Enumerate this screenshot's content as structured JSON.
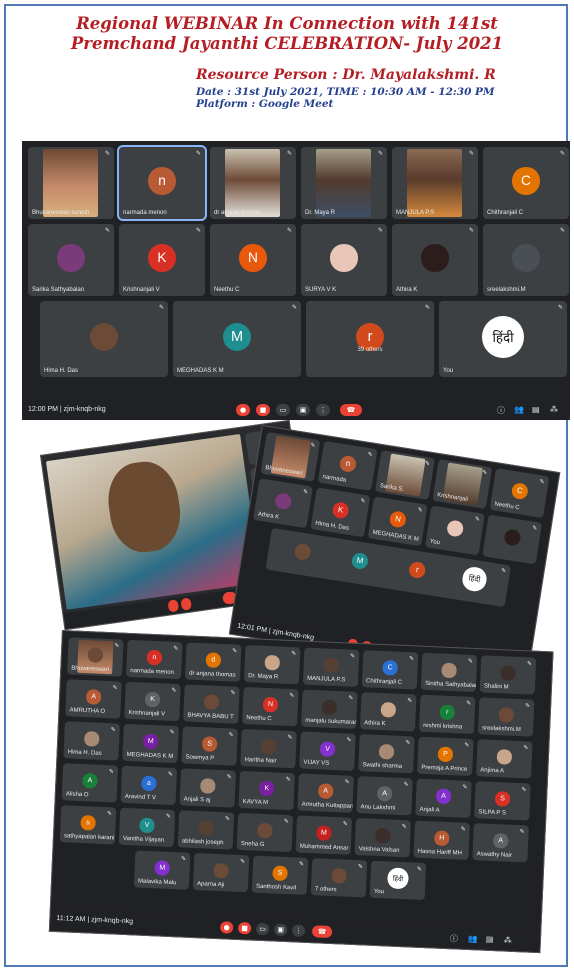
{
  "header": {
    "title_line1": "Regional WEBINAR In Connection with 141st",
    "title_line2": "Premchand Jayanthi CELEBRATION- July 2021",
    "resource_person": "Resource Person : Dr. Mayalakshmi. R",
    "date_time": "Date : 31st July 2021, TIME : 10:30 AM - 12:30 PM",
    "platform": "Platform    : Google Meet"
  },
  "meet1": {
    "clock": "12:00 PM  |  zjm-knqb-nkg",
    "participants": [
      "Bhuvaneswari suresh",
      "narmada menon",
      "dr anjana thomas",
      "Dr. Maya R",
      "MANJULA P.S",
      "Chithranjali C",
      "Sarika Sathyabalan",
      "Krishnanjali V",
      "Neethu C",
      "SURYA V K",
      "Athira K",
      "sreelakshmi.M",
      "Hima H. Das",
      "MEGHADAS K M",
      "39 others",
      "You"
    ],
    "avatar_letters": {
      "n": "n",
      "C": "C",
      "K": "K",
      "N": "N",
      "M": "M",
      "r": "r"
    },
    "hindi_text": "हिंदी"
  },
  "meet2": {
    "clock": "12:01 PM | zjm-knqb-nkg",
    "names": [
      "Bhuvaneswari",
      "narmada",
      "Sarika S.",
      "Krishnanjali",
      "Neethu C",
      "Athira K",
      "Hima H. Das",
      "MEGHADAS K M",
      "You"
    ]
  },
  "meet3": {
    "clock": "11:12 AM  |  zjm-knqb-nkg",
    "participants": [
      "Bhuvaneswari",
      "narmada menon",
      "dr anjana thomas",
      "Dr. Maya R",
      "MANJULA P.S",
      "Chithranjali C",
      "Sinitha Sathyabalan",
      "Shalini M",
      "AMRUTHA O",
      "Krishnanjali V",
      "BHAVYA BABU T",
      "Neethu C",
      "manjalu sukumaran",
      "Athira K",
      "reshmi krishna",
      "sreelakshmi.M",
      "Hima H. Das",
      "MEGHADAS K M",
      "Sowmya P",
      "Haritha Nair",
      "VIJAY VS",
      "Swathi sharma",
      "Premaja A Prince",
      "Anjima A",
      "Alisha O",
      "Aravind T V",
      "Anjali S aj",
      "KAVYA M",
      "Amrutha Kuttappan",
      "Anu Lakshmi",
      "Anjali A",
      "SILPA P S",
      "sathyapalan karani",
      "Vanitha Vijayan",
      "abhilash joseph",
      "Sneha G",
      "Muhammed Ansar",
      "Vaishna Valsan",
      "Hasna Hariff MH",
      "Aswathy Nair",
      "Malavika Malu",
      "Aparna Aji",
      "Santhosh Kavil",
      "7 others",
      "You"
    ]
  },
  "colors": {
    "title_red": "#b41e24",
    "meta_blue": "#233f8f",
    "meet_bg": "#202124",
    "tile_bg": "#3c4043",
    "end_call": "#ea4335"
  }
}
